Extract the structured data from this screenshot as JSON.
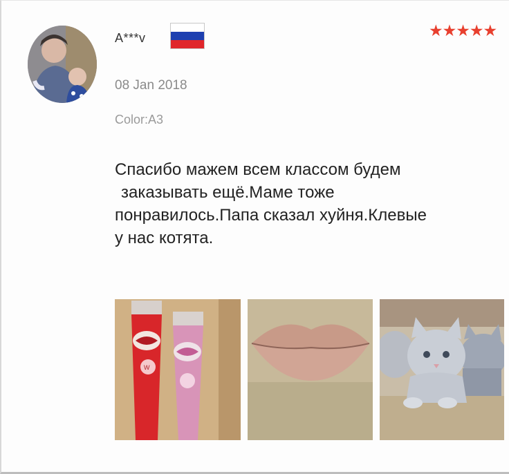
{
  "review": {
    "username": "A***v",
    "country_flag_icon": "russia-flag-icon",
    "rating": 5,
    "stars": "★★★★★",
    "date": "08 Jan 2018",
    "color_option": "Color:A3",
    "text_lines": [
      "Спасибо мажем всем классом будем",
      "заказывать ещё.Маме тоже",
      "понравилось.Папа сказал хуйня.Клевые",
      "у нас котята."
    ],
    "photos": [
      {
        "icon": "lip-gloss-tubes-photo"
      },
      {
        "icon": "lips-photo"
      },
      {
        "icon": "kittens-photo"
      }
    ]
  },
  "colors": {
    "star": "#e8402f",
    "meta_text": "#8a8a8a",
    "flag_white": "#ffffff",
    "flag_blue": "#1d3fb0",
    "flag_red": "#e0262b"
  }
}
